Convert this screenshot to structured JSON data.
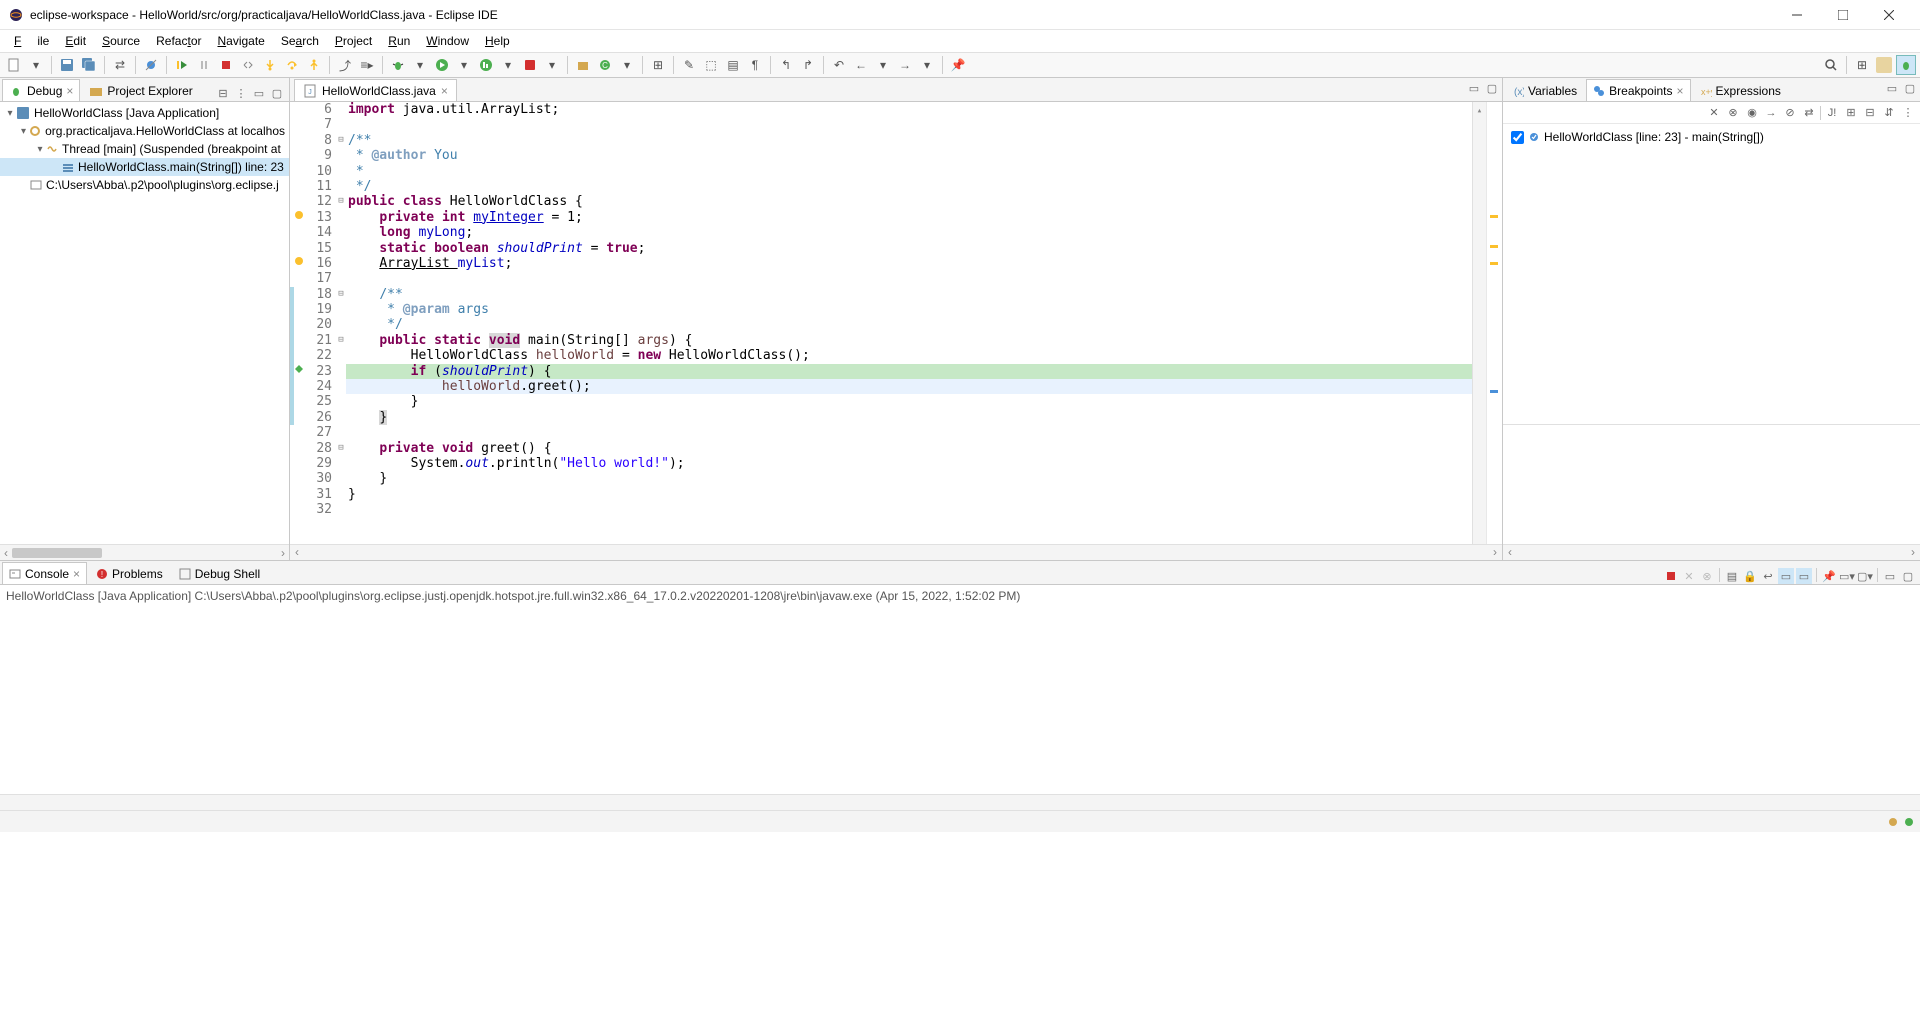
{
  "window": {
    "title": "eclipse-workspace - HelloWorld/src/org/practicaljava/HelloWorldClass.java - Eclipse IDE"
  },
  "menu": {
    "file": "File",
    "edit": "Edit",
    "source": "Source",
    "refactor": "Refactor",
    "navigate": "Navigate",
    "search": "Search",
    "project": "Project",
    "run": "Run",
    "window": "Window",
    "help": "Help"
  },
  "leftTabs": {
    "debug": "Debug",
    "projectExplorer": "Project Explorer"
  },
  "debugTree": {
    "app": "HelloWorldClass [Java Application]",
    "vm": "org.practicaljava.HelloWorldClass at localhos",
    "thread": "Thread [main] (Suspended (breakpoint at",
    "frame": "HelloWorldClass.main(String[]) line: 23",
    "jre": "C:\\Users\\Abba\\.p2\\pool\\plugins\\org.eclipse.j"
  },
  "editorTab": "HelloWorldClass.java",
  "code": {
    "l6": "import java.util.ArrayList;",
    "l8a": "/**",
    "l9a": " * ",
    "l9b": "@author",
    "l9c": " You",
    "l10": " *",
    "l11": " */",
    "l12a": "public",
    "l12b": "class",
    "l12c": " HelloWorldClass {",
    "l13a": "private",
    "l13b": "int",
    "l13c": "myInteger",
    "l13d": " = 1;",
    "l14a": "long",
    "l14b": "myLong",
    "l14c": ";",
    "l15a": "static",
    "l15b": "boolean",
    "l15c": "shouldPrint",
    "l15d": " = ",
    "l15e": "true",
    "l15f": ";",
    "l16a": "ArrayList ",
    "l16b": "myList",
    "l16c": ";",
    "l18a": "/**",
    "l19a": " * ",
    "l19b": "@param",
    "l19c": " args",
    "l20a": " */",
    "l21a": "public",
    "l21b": "static",
    "l21c": "void",
    "l21d": " main(String[] ",
    "l21e": "args",
    "l21f": ") {",
    "l22a": "HelloWorldClass ",
    "l22b": "helloWorld",
    "l22c": " = ",
    "l22d": "new",
    "l22e": " HelloWorldClass();",
    "l23a": "if",
    "l23b": " (",
    "l23c": "shouldPrint",
    "l23d": ") {",
    "l24a": "helloWorld",
    "l24b": ".greet();",
    "l25": "}",
    "l26": "}",
    "l28a": "private",
    "l28b": "void",
    "l28c": " greet() {",
    "l29a": "System.",
    "l29b": "out",
    "l29c": ".println(",
    "l29d": "\"Hello world!\"",
    "l29e": ");",
    "l30": "}",
    "l31": "}"
  },
  "rightTabs": {
    "variables": "Variables",
    "breakpoints": "Breakpoints",
    "expressions": "Expressions"
  },
  "breakpoint": "HelloWorldClass [line: 23] - main(String[])",
  "bottomTabs": {
    "console": "Console",
    "problems": "Problems",
    "debugShell": "Debug Shell"
  },
  "consoleHeader": "HelloWorldClass [Java Application] C:\\Users\\Abba\\.p2\\pool\\plugins\\org.eclipse.justj.openjdk.hotspot.jre.full.win32.x86_64_17.0.2.v20220201-1208\\jre\\bin\\javaw.exe  (Apr 15, 2022, 1:52:02 PM)",
  "lineNumbers": [
    "6",
    "7",
    "8",
    "9",
    "10",
    "11",
    "12",
    "13",
    "14",
    "15",
    "16",
    "17",
    "18",
    "19",
    "20",
    "21",
    "22",
    "23",
    "24",
    "25",
    "26",
    "27",
    "28",
    "29",
    "30",
    "31",
    "32"
  ]
}
